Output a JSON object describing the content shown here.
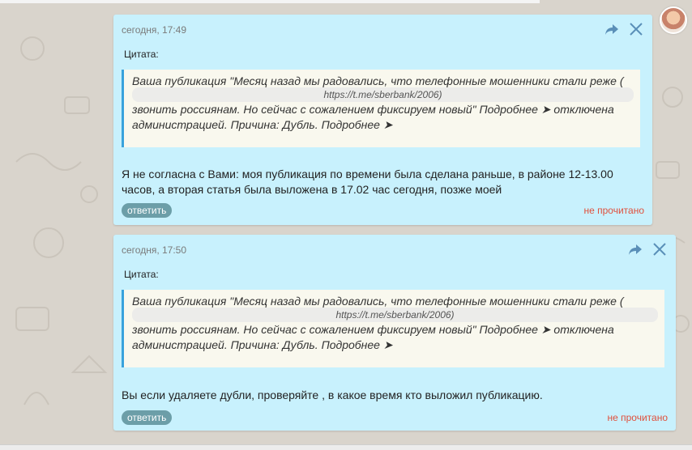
{
  "messages": [
    {
      "timestamp": "сегодня, 17:49",
      "quote_label": "Цитата:",
      "quote_line1": "Ваша публикация \"Месяц назад мы радовались, что телефонные мошенники стали реже (",
      "quote_link": "https://t.me/sberbank/2006)",
      "quote_line2": "звонить россиянам. Но сейчас с сожалением фиксируем новый\" Подробнее ➤ отключена",
      "quote_line3": "администрацией. Причина: Дубль. Подробнее ➤",
      "text": "Я не согласна с Вами: моя публикация по времени была сделана раньше, в районе 12-13.00 часов, а вторая статья была выложена в 17.02 час сегодня, позже моей",
      "reply_label": "ответить",
      "status": "не прочитано"
    },
    {
      "timestamp": "сегодня, 17:50",
      "quote_label": "Цитата:",
      "quote_line1": "Ваша публикация \"Месяц назад мы радовались, что телефонные мошенники стали реже (",
      "quote_link": "https://t.me/sberbank/2006)",
      "quote_line2": "звонить россиянам. Но сейчас с сожалением фиксируем новый\" Подробнее ➤ отключена",
      "quote_line3": "администрацией. Причина: Дубль. Подробнее ➤",
      "text": "Вы если удаляете дубли, проверяйте , в какое время кто выложил публикацию.",
      "reply_label": "ответить",
      "status": "не прочитано"
    }
  ],
  "colors": {
    "bubble": "#c8f1fd",
    "quote_bar": "#39a2dc",
    "reply_button": "#6c9ea8",
    "unread": "#e0503c"
  },
  "icons": [
    "forward-icon",
    "close-icon",
    "user-avatar"
  ]
}
